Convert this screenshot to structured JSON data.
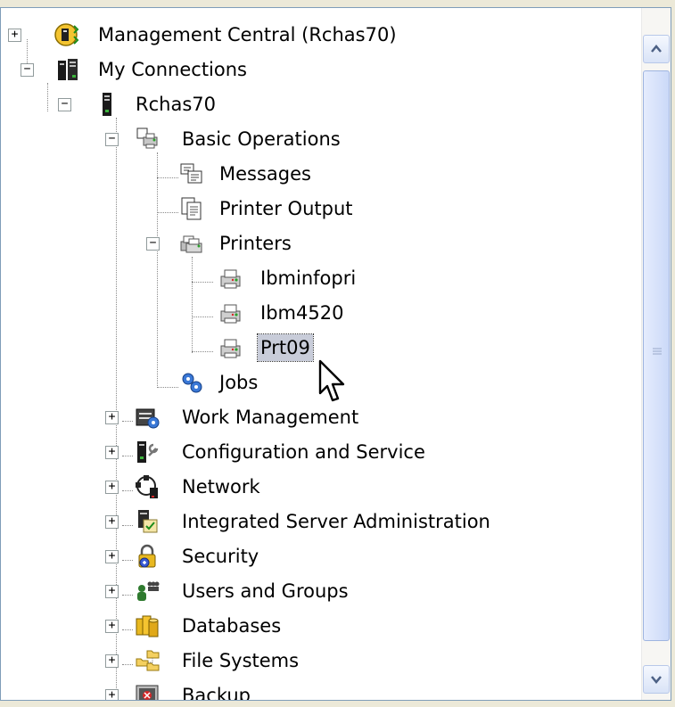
{
  "tree": {
    "nodes": [
      {
        "label": "Management Central (Rchas70)",
        "icon": "management-central-icon",
        "expander": "+"
      },
      {
        "label": "My Connections",
        "icon": "connections-icon",
        "expander": "−"
      },
      {
        "label": "Rchas70",
        "icon": "server-icon",
        "expander": "−"
      },
      {
        "label": "Basic Operations",
        "icon": "basic-operations-icon",
        "expander": "−"
      },
      {
        "label": "Messages",
        "icon": "messages-icon"
      },
      {
        "label": "Printer Output",
        "icon": "printer-output-icon"
      },
      {
        "label": "Printers",
        "icon": "printers-icon",
        "expander": "−"
      },
      {
        "label": "Ibminfopri",
        "icon": "printer-icon"
      },
      {
        "label": "Ibm4520",
        "icon": "printer-icon"
      },
      {
        "label": "Prt09",
        "icon": "printer-icon",
        "selected": true
      },
      {
        "label": "Jobs",
        "icon": "jobs-icon"
      },
      {
        "label": "Work Management",
        "icon": "work-management-icon",
        "expander": "+"
      },
      {
        "label": "Configuration and Service",
        "icon": "configuration-icon",
        "expander": "+"
      },
      {
        "label": "Network",
        "icon": "network-icon",
        "expander": "+"
      },
      {
        "label": "Integrated Server Administration",
        "icon": "integrated-server-icon",
        "expander": "+"
      },
      {
        "label": "Security",
        "icon": "security-icon",
        "expander": "+"
      },
      {
        "label": "Users and Groups",
        "icon": "users-groups-icon",
        "expander": "+"
      },
      {
        "label": "Databases",
        "icon": "databases-icon",
        "expander": "+"
      },
      {
        "label": "File Systems",
        "icon": "file-systems-icon",
        "expander": "+"
      },
      {
        "label": "Backup",
        "icon": "backup-icon",
        "expander": "+"
      }
    ]
  },
  "scrollbar": {
    "up_icon": "scroll-up-arrow-icon",
    "down_icon": "scroll-down-arrow-icon",
    "grip_icon": "scroll-grip-icon"
  },
  "colors": {
    "selection": "#c8ccd9",
    "tree_lines": "#8a8a8a",
    "scrollbar_accent": "#cbd9f8"
  }
}
